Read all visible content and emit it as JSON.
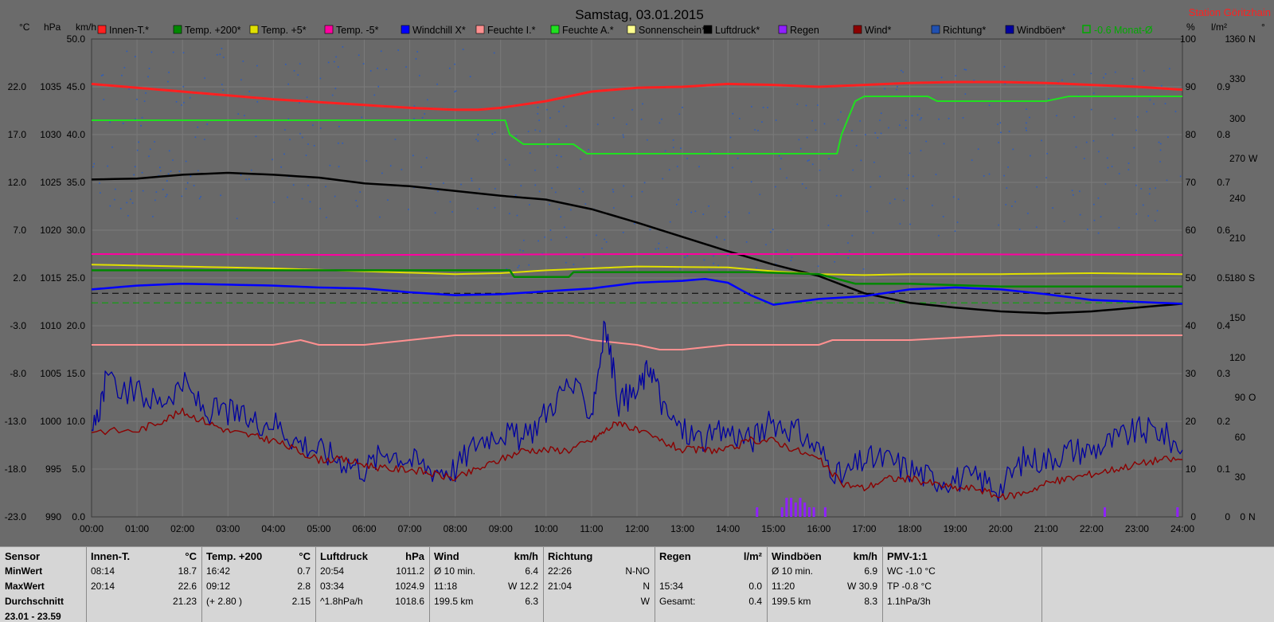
{
  "chart_data": {
    "type": "line",
    "title": "Samstag, 03.01.2015",
    "station": "Station Göritzhain",
    "left_axes": [
      {
        "unit": "°C",
        "ticks": [
          "22.0",
          "17.0",
          "12.0",
          "7.0",
          "2.0",
          "-3.0",
          "-8.0",
          "-13.0",
          "-18.0",
          "-23.0"
        ],
        "range": [
          -23,
          27
        ]
      },
      {
        "unit": "hPa",
        "ticks": [
          "1035",
          "1030",
          "1025",
          "1020",
          "1015",
          "1010",
          "1005",
          "1000",
          "995",
          "990"
        ],
        "range": [
          990,
          1040
        ]
      },
      {
        "unit": "km/h",
        "ticks": [
          "50.0",
          "45.0",
          "40.0",
          "35.0",
          "30.0",
          "25.0",
          "20.0",
          "15.0",
          "10.0",
          "5.0",
          "0.0"
        ],
        "range": [
          0,
          50
        ]
      }
    ],
    "right_axes": [
      {
        "unit": "%",
        "ticks": [
          "100",
          "90",
          "80",
          "70",
          "60",
          "50",
          "40",
          "30",
          "20",
          "10",
          "0"
        ],
        "range": [
          0,
          100
        ]
      },
      {
        "unit": "l/m²",
        "ticks": [
          "1",
          "0.9",
          "0.8",
          "0.7",
          "0.6",
          "0.5",
          "0.4",
          "0.3",
          "0.2",
          "0.1",
          "0"
        ],
        "range": [
          0,
          1
        ]
      },
      {
        "unit": "°",
        "ticks": [
          "360 N",
          "330",
          "300",
          "270 W",
          "240",
          "210",
          "180 S",
          "150",
          "120",
          "90 O",
          "60",
          "30",
          "0 N"
        ],
        "range": [
          0,
          360
        ]
      }
    ],
    "x_ticks": [
      "00:00",
      "01:00",
      "02:00",
      "03:00",
      "04:00",
      "05:00",
      "06:00",
      "07:00",
      "08:00",
      "09:00",
      "10:00",
      "11:00",
      "12:00",
      "13:00",
      "14:00",
      "15:00",
      "16:00",
      "17:00",
      "18:00",
      "19:00",
      "20:00",
      "21:00",
      "22:00",
      "23:00",
      "24:00"
    ],
    "xlim": [
      0,
      24
    ],
    "legend": [
      {
        "name": "Innen-T.*",
        "color": "#ff2020"
      },
      {
        "name": "Temp. +200*",
        "color": "#008800"
      },
      {
        "name": "Temp. +5*",
        "color": "#e0e000"
      },
      {
        "name": "Temp. -5*",
        "color": "#ff00a0"
      },
      {
        "name": "Windchill X*",
        "color": "#0000ff"
      },
      {
        "name": "Feuchte I.*",
        "color": "#ff9090"
      },
      {
        "name": "Feuchte A.*",
        "color": "#20e020"
      },
      {
        "name": "Sonnenschein*",
        "color": "#ffff90"
      },
      {
        "name": "Luftdruck*",
        "color": "#000000"
      },
      {
        "name": "Regen",
        "color": "#9020ff"
      },
      {
        "name": "Wind*",
        "color": "#8b0000"
      },
      {
        "name": "Richtung*",
        "color": "#2050b0"
      },
      {
        "name": "Windböen*",
        "color": "#0000a0"
      },
      {
        "name": "-0.6 Monat-Ø",
        "color": "#00aa00"
      }
    ],
    "series": [
      {
        "name": "Innen-T.*",
        "axis": "°C",
        "x": [
          0,
          1,
          2,
          3,
          4,
          5,
          6,
          7,
          8,
          8.5,
          9,
          10,
          11,
          12,
          13,
          14,
          15,
          16,
          17,
          18,
          19,
          20,
          21,
          22,
          23,
          24
        ],
        "values": [
          22.3,
          21.9,
          21.5,
          21.1,
          20.7,
          20.4,
          20.1,
          19.8,
          19.6,
          19.6,
          19.8,
          20.5,
          21.5,
          21.9,
          22.0,
          22.3,
          22.2,
          22.0,
          22.2,
          22.4,
          22.5,
          22.5,
          22.4,
          22.2,
          22.0,
          21.7
        ]
      },
      {
        "name": "Feuchte A.*",
        "axis": "%",
        "x": [
          0,
          9.1,
          9.2,
          9.5,
          10,
          10.6,
          10.9,
          11.5,
          16.4,
          16.5,
          16.8,
          17,
          18,
          18.4,
          18.6,
          21,
          21.5,
          24
        ],
        "values": [
          83,
          83,
          80,
          78,
          78,
          78,
          76,
          76,
          76,
          80,
          87,
          88,
          88,
          88,
          87,
          87,
          88,
          88
        ]
      },
      {
        "name": "Luftdruck*",
        "axis": "hPa",
        "x": [
          0,
          1,
          2,
          3,
          4,
          5,
          6,
          7,
          8,
          9,
          10,
          11,
          12,
          13,
          14,
          15,
          16,
          17,
          18,
          19,
          20,
          21,
          22,
          23,
          24
        ],
        "values": [
          1025.3,
          1025.4,
          1025.8,
          1026.0,
          1025.8,
          1025.5,
          1024.9,
          1024.6,
          1024.1,
          1023.6,
          1023.2,
          1022.2,
          1020.8,
          1019.3,
          1017.8,
          1016.4,
          1015.2,
          1013.4,
          1012.4,
          1011.9,
          1011.5,
          1011.3,
          1011.5,
          1011.9,
          1012.3
        ]
      },
      {
        "name": "Temp. -5*",
        "axis": "°C",
        "x": [
          0,
          6,
          12,
          18,
          24
        ],
        "values": [
          4.5,
          4.4,
          4.5,
          4.5,
          4.4
        ]
      },
      {
        "name": "Temp. +5*",
        "axis": "°C",
        "x": [
          0,
          2,
          4,
          6,
          8,
          9,
          10,
          12,
          14,
          15,
          16,
          17,
          18,
          20,
          22,
          24
        ],
        "values": [
          3.4,
          3.2,
          3.0,
          2.7,
          2.4,
          2.5,
          2.8,
          3.2,
          3.1,
          2.7,
          2.4,
          2.3,
          2.4,
          2.4,
          2.5,
          2.4
        ]
      },
      {
        "name": "Temp. +200*",
        "axis": "°C",
        "x": [
          0,
          4,
          8,
          9.2,
          9.3,
          10.5,
          10.6,
          14.6,
          16,
          16.8,
          17,
          18,
          20,
          24
        ],
        "values": [
          2.8,
          2.8,
          2.8,
          2.8,
          2.1,
          2.1,
          2.6,
          2.6,
          2.4,
          1.4,
          1.4,
          1.4,
          1.1,
          1.1
        ]
      },
      {
        "name": "Windchill X*",
        "axis": "°C",
        "x": [
          0,
          1,
          2,
          3,
          4,
          5,
          6,
          7,
          8,
          9,
          10,
          11,
          12,
          13,
          13.5,
          14,
          14.5,
          15,
          16,
          17,
          18,
          19,
          20,
          21,
          22,
          23,
          24
        ],
        "values": [
          0.8,
          1.2,
          1.4,
          1.3,
          1.2,
          1.0,
          0.9,
          0.5,
          0.2,
          0.3,
          0.6,
          0.9,
          1.5,
          1.7,
          1.9,
          1.5,
          0.2,
          -0.8,
          -0.2,
          0.1,
          0.8,
          1.0,
          0.8,
          0.3,
          -0.3,
          -0.5,
          -0.7
        ]
      },
      {
        "name": "Feuchte I.*",
        "axis": "%",
        "x": [
          0,
          4,
          4.6,
          5,
          6,
          7,
          8,
          9,
          10,
          10.5,
          11,
          12,
          12.5,
          13,
          14,
          15,
          16,
          16.3,
          17,
          18,
          20,
          24
        ],
        "values": [
          36,
          36,
          37,
          36,
          36,
          37,
          38,
          38,
          38,
          38,
          37,
          36,
          35,
          35,
          36,
          36,
          36,
          37,
          37,
          37,
          38,
          38
        ]
      },
      {
        "name": "Windböen*",
        "axis": "km/h",
        "x": [
          0,
          0.3,
          1,
          1.5,
          2,
          2.5,
          3,
          3.5,
          4,
          4.5,
          5,
          5.5,
          6,
          6.5,
          7,
          7.5,
          8,
          8.5,
          9,
          9.5,
          10,
          10.5,
          11,
          11.3,
          11.6,
          12,
          12.3,
          12.6,
          13,
          13.5,
          14,
          14.5,
          15,
          15.5,
          16,
          16.5,
          17,
          17.5,
          18,
          18.5,
          19,
          19.5,
          20,
          20.5,
          21,
          21.5,
          22,
          22.5,
          23,
          23.5,
          24
        ],
        "values": [
          8,
          14,
          13,
          12,
          14,
          11,
          11,
          10,
          10,
          8,
          7,
          6,
          5,
          7,
          6,
          5,
          5,
          8,
          9,
          8,
          11,
          14,
          11,
          20,
          12,
          13,
          16,
          11,
          9,
          8,
          9,
          8,
          10,
          9,
          7,
          4,
          6,
          6,
          5,
          4,
          4,
          4,
          3,
          6,
          6,
          7,
          7,
          8,
          9,
          9,
          7
        ]
      },
      {
        "name": "Wind*",
        "axis": "km/h",
        "x": [
          0,
          1,
          1.5,
          2,
          2.5,
          3,
          3.5,
          4,
          4.5,
          5,
          5.5,
          6,
          6.5,
          7,
          7.5,
          8,
          8.5,
          9,
          9.5,
          10,
          10.5,
          11,
          11.3,
          11.6,
          12,
          12.5,
          13,
          13.5,
          14,
          14.5,
          15,
          15.5,
          16,
          16.5,
          17,
          17.5,
          18,
          18.5,
          19,
          19.5,
          20,
          20.5,
          21,
          21.5,
          22,
          22.5,
          23,
          23.5,
          24
        ],
        "values": [
          9,
          9,
          10,
          11,
          10,
          9,
          8.5,
          8,
          7,
          6,
          6,
          5.5,
          5,
          5,
          4.5,
          4,
          5,
          6,
          7,
          7,
          7,
          8,
          9,
          10,
          9,
          8,
          7,
          7,
          7,
          8,
          8,
          7,
          6,
          3.5,
          3,
          4,
          4,
          3.5,
          3,
          3,
          2,
          2.5,
          3.5,
          4,
          4.5,
          5,
          5.5,
          6,
          6
        ]
      },
      {
        "name": "Regen",
        "axis": "l/m²",
        "type": "bar",
        "x": [
          14.65,
          15.2,
          15.3,
          15.4,
          15.5,
          15.6,
          15.7,
          15.8,
          15.9,
          16.15,
          22.3,
          23.9
        ],
        "values": [
          0.02,
          0.02,
          0.04,
          0.04,
          0.03,
          0.04,
          0.03,
          0.02,
          0.02,
          0.02,
          0.02,
          0.02
        ]
      }
    ],
    "reference_lines": [
      {
        "axis": "°C",
        "value": 0.4,
        "style": "dashed",
        "color": "#000000"
      },
      {
        "axis": "°C",
        "value": -0.6,
        "style": "dashed",
        "color": "#00aa00"
      }
    ]
  },
  "panel": {
    "columns": [
      {
        "key": "sensor",
        "rows": [
          [
            "Sensor",
            ""
          ],
          [
            "MinWert",
            ""
          ],
          [
            "MaxWert",
            ""
          ],
          [
            "Durchschnitt",
            ""
          ],
          [
            "23.01 - 23.59",
            ""
          ]
        ]
      },
      {
        "key": "innen",
        "rows": [
          [
            "Innen-T.",
            "°C"
          ],
          [
            "08:14",
            "18.7"
          ],
          [
            "20:14",
            "22.6"
          ],
          [
            "",
            "21.23"
          ],
          [
            "",
            ""
          ]
        ]
      },
      {
        "key": "temp200",
        "rows": [
          [
            "Temp. +200",
            "°C"
          ],
          [
            "16:42",
            "0.7"
          ],
          [
            "09:12",
            "2.8"
          ],
          [
            "(+ 2.80 )",
            "2.15"
          ],
          [
            "",
            ""
          ]
        ]
      },
      {
        "key": "luftdruck",
        "rows": [
          [
            "Luftdruck",
            "hPa"
          ],
          [
            "20:54",
            "1011.2"
          ],
          [
            "03:34",
            "1024.9"
          ],
          [
            "^1.8hPa/h",
            "1018.6"
          ],
          [
            "",
            ""
          ]
        ]
      },
      {
        "key": "wind",
        "rows": [
          [
            "Wind",
            "km/h"
          ],
          [
            "Ø 10 min.",
            "6.4"
          ],
          [
            "11:18",
            "W 12.2"
          ],
          [
            "199.5 km",
            "6.3"
          ],
          [
            "",
            ""
          ]
        ]
      },
      {
        "key": "richtung",
        "rows": [
          [
            "Richtung",
            ""
          ],
          [
            "22:26",
            "N-NO"
          ],
          [
            "21:04",
            "N"
          ],
          [
            "",
            "W"
          ],
          [
            "",
            ""
          ]
        ]
      },
      {
        "key": "regen",
        "rows": [
          [
            "Regen",
            "l/m²"
          ],
          [
            "",
            ""
          ],
          [
            "15:34",
            "0.0"
          ],
          [
            "Gesamt:",
            "0.4"
          ],
          [
            "",
            ""
          ]
        ]
      },
      {
        "key": "windboen",
        "rows": [
          [
            "Windböen",
            "km/h"
          ],
          [
            "Ø 10 min.",
            "6.9"
          ],
          [
            "11:20",
            "W 30.9"
          ],
          [
            "199.5 km",
            "8.3"
          ],
          [
            "",
            ""
          ]
        ]
      },
      {
        "key": "pmv",
        "rows": [
          [
            "PMV-1:1",
            ""
          ],
          [
            "WC -1.0 °C",
            ""
          ],
          [
            "TP -0.8 °C",
            ""
          ],
          [
            "1.1hPa/3h",
            ""
          ],
          [
            "",
            ""
          ]
        ]
      }
    ]
  }
}
